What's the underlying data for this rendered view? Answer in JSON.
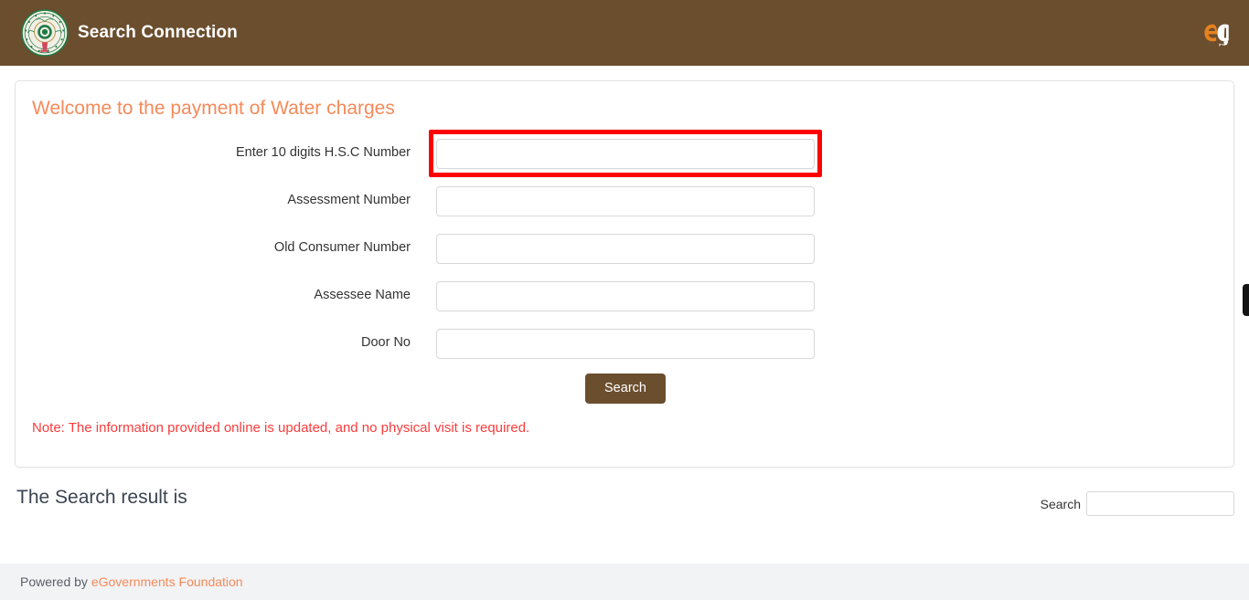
{
  "header": {
    "title": "Search Connection",
    "emblem_icon": "andhra-pradesh-government-emblem",
    "brand_icon": "egov-logo-icon",
    "background_color": "#6b4e2e",
    "title_color": "#ffffff"
  },
  "card": {
    "heading": "Welcome to the payment of Water charges",
    "heading_color": "#f58a5a",
    "fields": [
      {
        "label": "Enter 10 digits H.S.C Number",
        "value": "",
        "placeholder": "",
        "highlighted": true
      },
      {
        "label": "Assessment Number",
        "value": "",
        "placeholder": "",
        "highlighted": false
      },
      {
        "label": "Old Consumer Number",
        "value": "",
        "placeholder": "",
        "highlighted": false
      },
      {
        "label": "Assessee Name",
        "value": "",
        "placeholder": "",
        "highlighted": false
      },
      {
        "label": "Door No",
        "value": "",
        "placeholder": "",
        "highlighted": false
      }
    ],
    "search_button_label": "Search",
    "search_button_color": "#6b4e2e",
    "note": "Note: The information provided online is updated, and no physical visit is required.",
    "note_color": "#fa3c3c"
  },
  "results": {
    "heading": "The Search result is",
    "filter_label": "Search",
    "filter_value": "",
    "filter_placeholder": ""
  },
  "footer": {
    "prefix": "Powered by ",
    "link_label": "eGovernments Foundation",
    "link_color": "#f58a5a",
    "background_color": "#f2f3f5"
  },
  "annotations": {
    "highlight_color": "#ff0000"
  }
}
